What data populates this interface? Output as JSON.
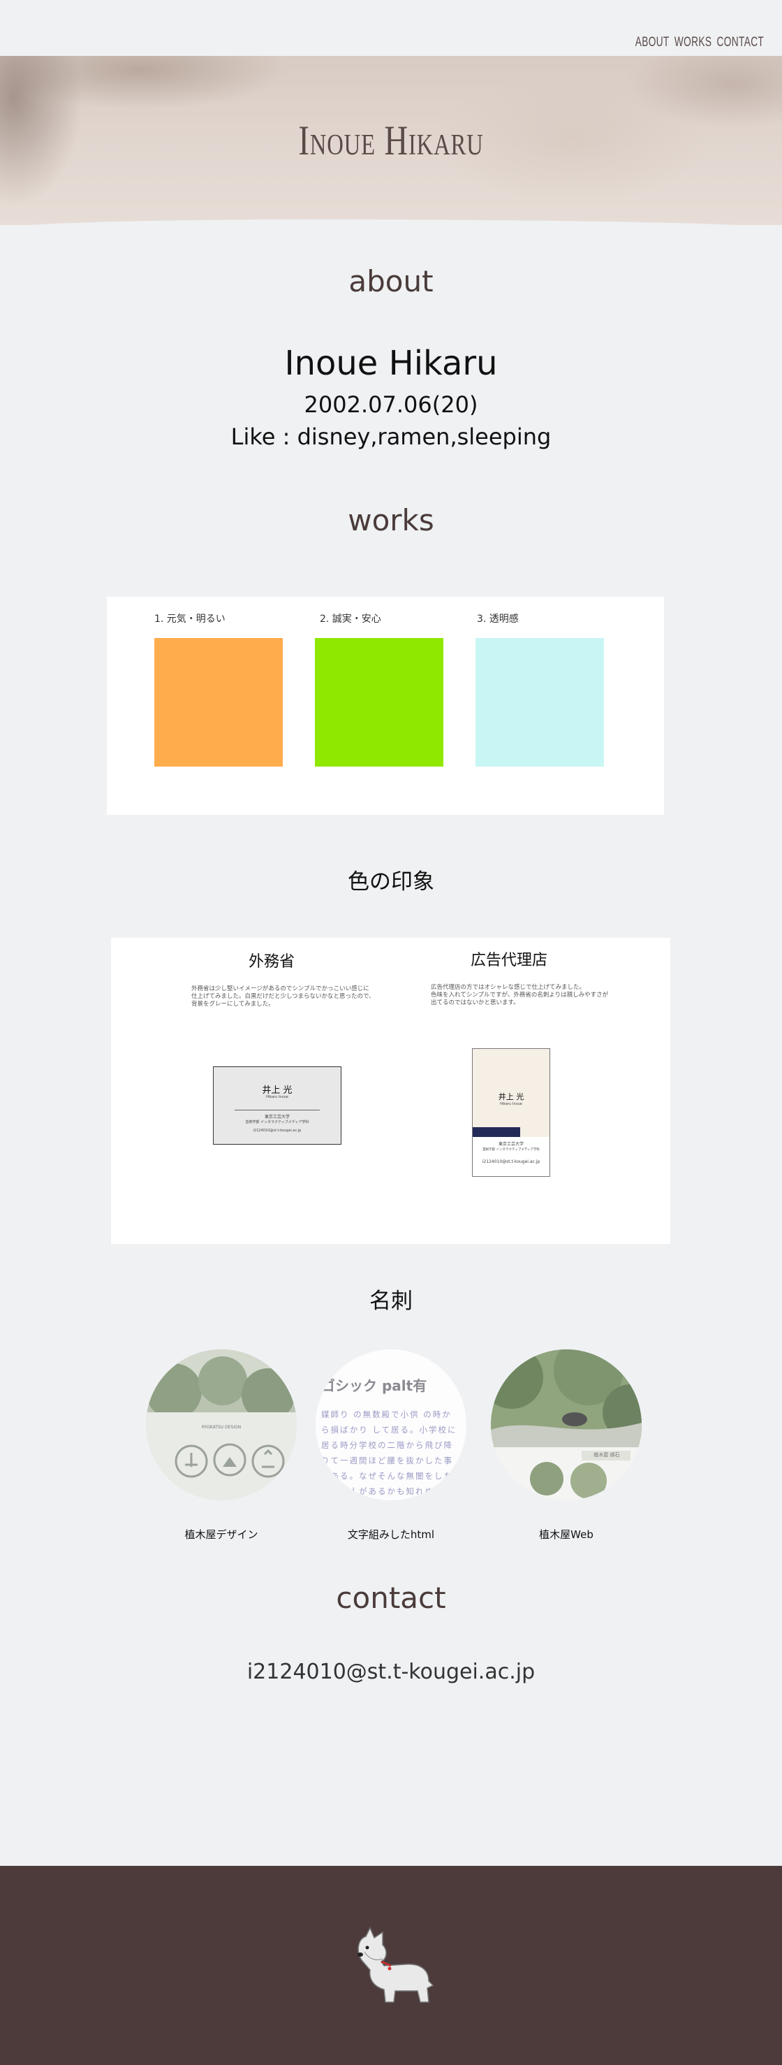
{
  "nav": {
    "items": [
      "ABOUT",
      "WORKS",
      "CONTACT"
    ]
  },
  "hero": {
    "title": "Inoue Hikaru"
  },
  "about": {
    "heading": "about",
    "name": "Inoue Hikaru",
    "birthday": "2002.07.06(20)",
    "like": "Like : disney,ramen,sleeping"
  },
  "works": {
    "heading": "works",
    "colors": [
      {
        "label": "1. 元気・明るい",
        "hex": "#ffac4d"
      },
      {
        "label": "2. 誠実・安心",
        "hex": "#8fe800"
      },
      {
        "label": "3. 透明感",
        "hex": "#c8f6f4"
      }
    ],
    "colors_title": "色の印象",
    "cards": {
      "left": {
        "title": "外務省",
        "desc": [
          "外務省は少し堅いイメージがあるのでシンプルでかっこいい感じに",
          "仕上げてみました。白黒だけだと少しつまらないかなと思ったので、",
          "背景をグレーにしてみました。"
        ],
        "card_name": "井上 光",
        "card_roman": "Hikaru Inoue",
        "card_school": "東京工芸大学",
        "card_dept": "芸術学部 インタラクティブメディア学科",
        "card_mail": "i2124010@st.t-kougei.ac.jp"
      },
      "right": {
        "title": "広告代理店",
        "desc": [
          "広告代理店の方ではオシャレな感じで仕上げてみました。",
          "色味を入れてシンプルですが、外務省の名刺よりは親しみやすさが",
          "出てるのではないかと思います。"
        ],
        "card_name": "井上 光",
        "card_roman": "Hikaru Inoue",
        "card_school": "東京工芸大学",
        "card_dept": "芸術学部 インタラクティブメディア学科",
        "card_mail": "i2124010@st.t-kougei.ac.jp"
      }
    },
    "cards_title": "名刺",
    "thumbs": [
      {
        "label": "植木屋デザイン",
        "inner_text": "RYOKATSU DESIGN"
      },
      {
        "label": "文字組みしたhtml",
        "inner_text": "游ゴシック palt有",
        "body_text": "媒師り の無数殿で小供 の時から損ばかり して居る。小学校に居る時分学校の二階から飛び降りて一週間ほど腰を抜かした事がある。なぜそんな無闇をしたと聞く人があるかも知れぬ。別段深い理由でもない。新築の二階から首を出していたら、同級生の一人が冗談に、いくら威張っても、そこから飛び降りる事は出来まい。"
      },
      {
        "label": "植木屋Web",
        "inner_text": "植木屋 緑石"
      }
    ]
  },
  "contact": {
    "heading": "contact",
    "email": "i2124010@st.t-kougei.ac.jp"
  },
  "colors": {
    "background": "#eff1f3",
    "footer": "#4d3b3c",
    "heading": "#4a3b3a",
    "navy": "#242a57"
  }
}
